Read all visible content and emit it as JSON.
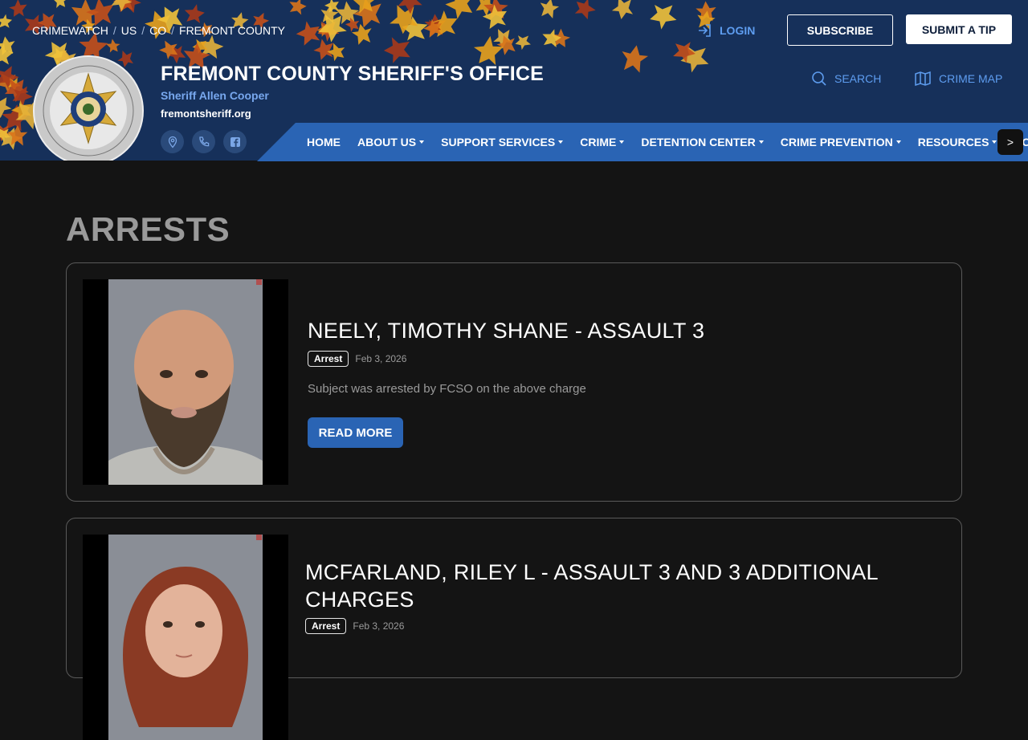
{
  "breadcrumb": [
    "CRIMEWATCH",
    "US",
    "CO",
    "FREMONT COUNTY"
  ],
  "header": {
    "login_label": "LOGIN",
    "subscribe_label": "SUBSCRIBE",
    "submit_tip_label": "SUBMIT A TIP",
    "office_title": "FREMONT COUNTY SHERIFF'S OFFICE",
    "sheriff_name": "Sheriff Allen Cooper",
    "website": "fremontsheriff.org",
    "search_label": "SEARCH",
    "crime_map_label": "CRIME MAP",
    "icons": [
      "location-icon",
      "phone-icon",
      "facebook-icon"
    ]
  },
  "nav": {
    "items": [
      "HOME",
      "ABOUT US",
      "SUPPORT SERVICES",
      "CRIME",
      "DETENTION CENTER",
      "CRIME PREVENTION",
      "RESOURCES",
      "CONTACT"
    ],
    "next_label": ">"
  },
  "page": {
    "title": "ARRESTS",
    "posts": [
      {
        "title": "NEELY, TIMOTHY SHANE - ASSAULT 3",
        "tag": "Arrest",
        "date": "Feb 3, 2026",
        "summary": "Subject was arrested by FCSO on the above charge",
        "button": "READ MORE"
      },
      {
        "title": "MCFARLAND, RILEY L - ASSAULT 3 AND 3 ADDITIONAL CHARGES",
        "tag": "Arrest",
        "date": "Feb 3, 2026"
      }
    ]
  },
  "colors": {
    "header_bg": "#16305a",
    "nav_bg": "#2a64b4",
    "accent_link": "#5e9df0",
    "page_bg": "#141414"
  }
}
